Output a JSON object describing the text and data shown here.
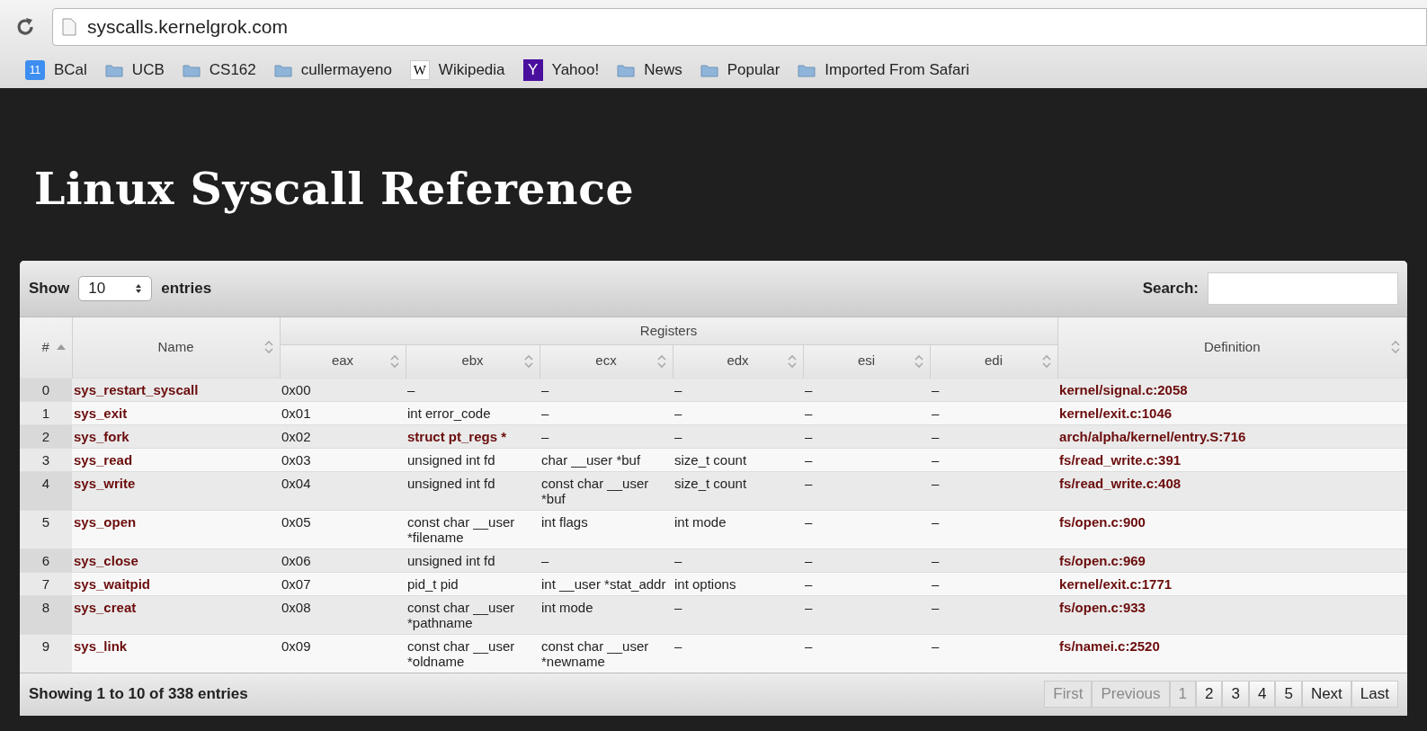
{
  "browser": {
    "url": "syscalls.kernelgrok.com",
    "bookmarks": [
      {
        "label": "BCal",
        "kind": "calendar",
        "icon_text": "11"
      },
      {
        "label": "UCB",
        "kind": "folder"
      },
      {
        "label": "CS162",
        "kind": "folder"
      },
      {
        "label": "cullermayeno",
        "kind": "folder"
      },
      {
        "label": "Wikipedia",
        "kind": "wiki",
        "icon_text": "W"
      },
      {
        "label": "Yahoo!",
        "kind": "yahoo",
        "icon_text": "Y"
      },
      {
        "label": "News",
        "kind": "folder"
      },
      {
        "label": "Popular",
        "kind": "folder"
      },
      {
        "label": "Imported From Safari",
        "kind": "folder"
      }
    ]
  },
  "page": {
    "title": "Linux Syscall Reference"
  },
  "table": {
    "length_label_before": "Show",
    "length_value": "10",
    "length_label_after": "entries",
    "search_label": "Search:",
    "group_header": "Registers",
    "columns": [
      {
        "label": "#",
        "sorted": true
      },
      {
        "label": "Name",
        "sorted": false
      },
      {
        "label": "eax",
        "sorted": false
      },
      {
        "label": "ebx",
        "sorted": false
      },
      {
        "label": "ecx",
        "sorted": false
      },
      {
        "label": "edx",
        "sorted": false
      },
      {
        "label": "esi",
        "sorted": false
      },
      {
        "label": "edi",
        "sorted": false
      },
      {
        "label": "Definition",
        "sorted": false
      }
    ],
    "rows": [
      {
        "num": "0",
        "name": "sys_restart_syscall",
        "registers": [
          {
            "text": "0x00",
            "kind": "plain"
          },
          {
            "text": "–",
            "kind": "plain"
          },
          {
            "text": "–",
            "kind": "plain"
          },
          {
            "text": "–",
            "kind": "plain"
          },
          {
            "text": "–",
            "kind": "plain"
          },
          {
            "text": "–",
            "kind": "plain"
          }
        ],
        "definition": "kernel/signal.c:2058"
      },
      {
        "num": "1",
        "name": "sys_exit",
        "registers": [
          {
            "text": "0x01",
            "kind": "plain"
          },
          {
            "text": "int error_code",
            "kind": "plain"
          },
          {
            "text": "–",
            "kind": "plain"
          },
          {
            "text": "–",
            "kind": "plain"
          },
          {
            "text": "–",
            "kind": "plain"
          },
          {
            "text": "–",
            "kind": "plain"
          }
        ],
        "definition": "kernel/exit.c:1046"
      },
      {
        "num": "2",
        "name": "sys_fork",
        "registers": [
          {
            "text": "0x02",
            "kind": "plain"
          },
          {
            "text": "struct pt_regs *",
            "kind": "link"
          },
          {
            "text": "–",
            "kind": "plain"
          },
          {
            "text": "–",
            "kind": "plain"
          },
          {
            "text": "–",
            "kind": "plain"
          },
          {
            "text": "–",
            "kind": "plain"
          }
        ],
        "definition": "arch/alpha/kernel/entry.S:716"
      },
      {
        "num": "3",
        "name": "sys_read",
        "registers": [
          {
            "text": "0x03",
            "kind": "plain"
          },
          {
            "text": "unsigned int fd",
            "kind": "plain"
          },
          {
            "text": "char __user *buf",
            "kind": "plain"
          },
          {
            "text": "size_t count",
            "kind": "plain"
          },
          {
            "text": "–",
            "kind": "plain"
          },
          {
            "text": "–",
            "kind": "plain"
          }
        ],
        "definition": "fs/read_write.c:391"
      },
      {
        "num": "4",
        "name": "sys_write",
        "registers": [
          {
            "text": "0x04",
            "kind": "plain"
          },
          {
            "text": "unsigned int fd",
            "kind": "plain"
          },
          {
            "text": "const char __user *buf",
            "kind": "plain"
          },
          {
            "text": "size_t count",
            "kind": "plain"
          },
          {
            "text": "–",
            "kind": "plain"
          },
          {
            "text": "–",
            "kind": "plain"
          }
        ],
        "definition": "fs/read_write.c:408"
      },
      {
        "num": "5",
        "name": "sys_open",
        "registers": [
          {
            "text": "0x05",
            "kind": "plain"
          },
          {
            "text": "const char __user *filename",
            "kind": "plain"
          },
          {
            "text": "int flags",
            "kind": "plain"
          },
          {
            "text": "int mode",
            "kind": "plain"
          },
          {
            "text": "–",
            "kind": "plain"
          },
          {
            "text": "–",
            "kind": "plain"
          }
        ],
        "definition": "fs/open.c:900"
      },
      {
        "num": "6",
        "name": "sys_close",
        "registers": [
          {
            "text": "0x06",
            "kind": "plain"
          },
          {
            "text": "unsigned int fd",
            "kind": "plain"
          },
          {
            "text": "–",
            "kind": "plain"
          },
          {
            "text": "–",
            "kind": "plain"
          },
          {
            "text": "–",
            "kind": "plain"
          },
          {
            "text": "–",
            "kind": "plain"
          }
        ],
        "definition": "fs/open.c:969"
      },
      {
        "num": "7",
        "name": "sys_waitpid",
        "registers": [
          {
            "text": "0x07",
            "kind": "plain"
          },
          {
            "text": "pid_t pid",
            "kind": "plain"
          },
          {
            "text": "int __user *stat_addr",
            "kind": "plain"
          },
          {
            "text": "int options",
            "kind": "plain"
          },
          {
            "text": "–",
            "kind": "plain"
          },
          {
            "text": "–",
            "kind": "plain"
          }
        ],
        "definition": "kernel/exit.c:1771"
      },
      {
        "num": "8",
        "name": "sys_creat",
        "registers": [
          {
            "text": "0x08",
            "kind": "plain"
          },
          {
            "text": "const char __user *pathname",
            "kind": "plain"
          },
          {
            "text": "int mode",
            "kind": "plain"
          },
          {
            "text": "–",
            "kind": "plain"
          },
          {
            "text": "–",
            "kind": "plain"
          },
          {
            "text": "–",
            "kind": "plain"
          }
        ],
        "definition": "fs/open.c:933"
      },
      {
        "num": "9",
        "name": "sys_link",
        "registers": [
          {
            "text": "0x09",
            "kind": "plain"
          },
          {
            "text": "const char __user *oldname",
            "kind": "plain"
          },
          {
            "text": "const char __user *newname",
            "kind": "plain"
          },
          {
            "text": "–",
            "kind": "plain"
          },
          {
            "text": "–",
            "kind": "plain"
          },
          {
            "text": "–",
            "kind": "plain"
          }
        ],
        "definition": "fs/namei.c:2520"
      }
    ],
    "info": "Showing 1 to 10 of 338 entries",
    "pagination": [
      {
        "label": "First",
        "disabled": true
      },
      {
        "label": "Previous",
        "disabled": true
      },
      {
        "label": "1",
        "disabled": true
      },
      {
        "label": "2",
        "disabled": false
      },
      {
        "label": "3",
        "disabled": false
      },
      {
        "label": "4",
        "disabled": false
      },
      {
        "label": "5",
        "disabled": false
      },
      {
        "label": "Next",
        "disabled": false
      },
      {
        "label": "Last",
        "disabled": false
      }
    ]
  }
}
